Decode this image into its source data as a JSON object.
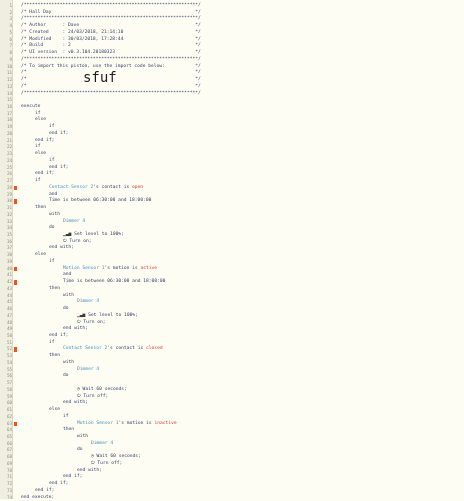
{
  "code_lines": [
    {
      "n": "1",
      "indent": 0,
      "tokens": [
        [
          "com",
          "/***************************************************************/"
        ]
      ]
    },
    {
      "n": "2",
      "indent": 0,
      "tokens": [
        [
          "com",
          "/* Hall Day                                                    */"
        ]
      ]
    },
    {
      "n": "3",
      "indent": 0,
      "tokens": [
        [
          "com",
          "/***************************************************************/"
        ]
      ]
    },
    {
      "n": "4",
      "indent": 0,
      "tokens": [
        [
          "com",
          "/* Author      : Dave                                          */"
        ]
      ]
    },
    {
      "n": "5",
      "indent": 0,
      "tokens": [
        [
          "com",
          "/* Created     : 24/03/2018, 21:14:10                          */"
        ]
      ]
    },
    {
      "n": "6",
      "indent": 0,
      "tokens": [
        [
          "com",
          "/* Modified    : 30/03/2018, 17:28:44                          */"
        ]
      ]
    },
    {
      "n": "7",
      "indent": 0,
      "tokens": [
        [
          "com",
          "/* Build       : 2                                             */"
        ]
      ]
    },
    {
      "n": "8",
      "indent": 0,
      "tokens": [
        [
          "com",
          "/* UI version  : v0.3.104.20180323                             */"
        ]
      ]
    },
    {
      "n": "9",
      "indent": 0,
      "tokens": [
        [
          "com",
          "/***************************************************************/"
        ]
      ]
    },
    {
      "n": "10",
      "indent": 0,
      "tokens": [
        [
          "com",
          "/* To import this piston, use the import code below:           */"
        ]
      ]
    },
    {
      "n": "11",
      "indent": 0,
      "tokens": [
        [
          "com",
          "/*                                                             */"
        ]
      ]
    },
    {
      "n": "12",
      "indent": 0,
      "tokens": [
        [
          "com",
          "/*                                                             */"
        ]
      ]
    },
    {
      "n": "13",
      "indent": 0,
      "tokens": [
        [
          "com",
          "/*                                                             */"
        ]
      ]
    },
    {
      "n": "14",
      "indent": 0,
      "tokens": [
        [
          "com",
          "/***************************************************************/"
        ]
      ]
    },
    {
      "n": "15",
      "indent": 0,
      "tokens": []
    },
    {
      "n": "16",
      "indent": 0,
      "tokens": [
        [
          "kw",
          "execute"
        ]
      ]
    },
    {
      "n": "17",
      "indent": 1,
      "tokens": [
        [
          "kw",
          "if"
        ]
      ]
    },
    {
      "n": "18",
      "indent": 1,
      "tokens": [
        [
          "kw",
          "else"
        ]
      ]
    },
    {
      "n": "19",
      "indent": 2,
      "tokens": [
        [
          "kw",
          "if"
        ]
      ]
    },
    {
      "n": "20",
      "indent": 2,
      "tokens": [
        [
          "kw",
          "end if;"
        ]
      ]
    },
    {
      "n": "21",
      "indent": 1,
      "tokens": [
        [
          "kw",
          "end if;"
        ]
      ]
    },
    {
      "n": "22",
      "indent": 1,
      "tokens": [
        [
          "kw",
          "if"
        ]
      ]
    },
    {
      "n": "23",
      "indent": 1,
      "tokens": [
        [
          "kw",
          "else"
        ]
      ]
    },
    {
      "n": "24",
      "indent": 2,
      "tokens": [
        [
          "kw",
          "if"
        ]
      ]
    },
    {
      "n": "25",
      "indent": 2,
      "tokens": [
        [
          "kw",
          "end if;"
        ]
      ]
    },
    {
      "n": "26",
      "indent": 1,
      "tokens": [
        [
          "kw",
          "end if;"
        ]
      ]
    },
    {
      "n": "27",
      "indent": 1,
      "tokens": [
        [
          "kw",
          "if"
        ]
      ]
    },
    {
      "n": "28",
      "indent": 2,
      "flag": true,
      "tokens": [
        [
          "dev",
          "Contact Sensor 2"
        ],
        [
          "txt",
          "'s contact is "
        ],
        [
          "val",
          "open"
        ]
      ]
    },
    {
      "n": "29",
      "indent": 2,
      "tokens": [
        [
          "kw",
          "and"
        ]
      ]
    },
    {
      "n": "30",
      "indent": 2,
      "flag": true,
      "tokens": [
        [
          "txt",
          "Time is between "
        ],
        [
          "num",
          "06:30:00"
        ],
        [
          "txt",
          " and "
        ],
        [
          "num",
          "18:00:00"
        ]
      ]
    },
    {
      "n": "31",
      "indent": 1,
      "tokens": [
        [
          "kw",
          "then"
        ]
      ]
    },
    {
      "n": "32",
      "indent": 2,
      "tokens": [
        [
          "kw",
          "with"
        ]
      ]
    },
    {
      "n": "33",
      "indent": 3,
      "tokens": [
        [
          "dev",
          "Dimmer 4"
        ]
      ]
    },
    {
      "n": "34",
      "indent": 2,
      "tokens": [
        [
          "kw",
          "do"
        ]
      ]
    },
    {
      "n": "35",
      "indent": 3,
      "tokens": [
        [
          "ico",
          "▁▃▅ "
        ],
        [
          "txt",
          "Set level to "
        ],
        [
          "num",
          "100%"
        ],
        [
          "txt",
          ";"
        ]
      ]
    },
    {
      "n": "36",
      "indent": 3,
      "tokens": [
        [
          "ico",
          "⏻ "
        ],
        [
          "txt",
          "Turn on;"
        ]
      ]
    },
    {
      "n": "37",
      "indent": 2,
      "tokens": [
        [
          "kw",
          "end with;"
        ]
      ]
    },
    {
      "n": "38",
      "indent": 1,
      "tokens": [
        [
          "kw",
          "else"
        ]
      ]
    },
    {
      "n": "39",
      "indent": 2,
      "tokens": [
        [
          "kw",
          "if"
        ]
      ]
    },
    {
      "n": "40",
      "indent": 3,
      "flag": true,
      "tokens": [
        [
          "dev",
          "Motion Sensor 1"
        ],
        [
          "txt",
          "'s motion is "
        ],
        [
          "val",
          "active"
        ]
      ]
    },
    {
      "n": "41",
      "indent": 3,
      "tokens": [
        [
          "kw",
          "and"
        ]
      ]
    },
    {
      "n": "42",
      "indent": 3,
      "flag": true,
      "tokens": [
        [
          "txt",
          "Time is between "
        ],
        [
          "num",
          "06:30:00"
        ],
        [
          "txt",
          " and "
        ],
        [
          "num",
          "18:00:00"
        ]
      ]
    },
    {
      "n": "43",
      "indent": 2,
      "tokens": [
        [
          "kw",
          "then"
        ]
      ]
    },
    {
      "n": "44",
      "indent": 3,
      "tokens": [
        [
          "kw",
          "with"
        ]
      ]
    },
    {
      "n": "45",
      "indent": 4,
      "tokens": [
        [
          "dev",
          "Dimmer 4"
        ]
      ]
    },
    {
      "n": "46",
      "indent": 3,
      "tokens": [
        [
          "kw",
          "do"
        ]
      ]
    },
    {
      "n": "47",
      "indent": 4,
      "tokens": [
        [
          "ico",
          "▁▃▅ "
        ],
        [
          "txt",
          "Set level to "
        ],
        [
          "num",
          "100%"
        ],
        [
          "txt",
          ";"
        ]
      ]
    },
    {
      "n": "48",
      "indent": 4,
      "tokens": [
        [
          "ico",
          "⏻ "
        ],
        [
          "txt",
          "Turn on;"
        ]
      ]
    },
    {
      "n": "49",
      "indent": 3,
      "tokens": [
        [
          "kw",
          "end with;"
        ]
      ]
    },
    {
      "n": "50",
      "indent": 2,
      "tokens": [
        [
          "kw",
          "end if;"
        ]
      ]
    },
    {
      "n": "51",
      "indent": 2,
      "tokens": [
        [
          "kw",
          "if"
        ]
      ]
    },
    {
      "n": "52",
      "indent": 3,
      "flag": true,
      "tokens": [
        [
          "dev",
          "Contact Sensor 2"
        ],
        [
          "txt",
          "'s contact is "
        ],
        [
          "val",
          "closed"
        ]
      ]
    },
    {
      "n": "53",
      "indent": 2,
      "tokens": [
        [
          "kw",
          "then"
        ]
      ]
    },
    {
      "n": "54",
      "indent": 3,
      "tokens": [
        [
          "kw",
          "with"
        ]
      ]
    },
    {
      "n": "55",
      "indent": 4,
      "tokens": [
        [
          "dev",
          "Dimmer 4"
        ]
      ]
    },
    {
      "n": "56",
      "indent": 3,
      "tokens": [
        [
          "kw",
          "do"
        ]
      ]
    },
    {
      "n": "57",
      "indent": 4,
      "tokens": []
    },
    {
      "n": "58",
      "indent": 4,
      "tokens": [
        [
          "ico",
          "◷ "
        ],
        [
          "txt",
          "Wait "
        ],
        [
          "num",
          "60"
        ],
        [
          "txt",
          " seconds;"
        ]
      ]
    },
    {
      "n": "59",
      "indent": 4,
      "tokens": [
        [
          "ico",
          "⏻ "
        ],
        [
          "txt",
          "Turn off;"
        ]
      ]
    },
    {
      "n": "60",
      "indent": 3,
      "tokens": [
        [
          "kw",
          "end with;"
        ]
      ]
    },
    {
      "n": "61",
      "indent": 2,
      "tokens": [
        [
          "kw",
          "else"
        ]
      ]
    },
    {
      "n": "62",
      "indent": 3,
      "tokens": [
        [
          "kw",
          "if"
        ]
      ]
    },
    {
      "n": "63",
      "indent": 4,
      "flag": true,
      "tokens": [
        [
          "dev",
          "Motion Sensor 1"
        ],
        [
          "txt",
          "'s motion is "
        ],
        [
          "val",
          "inactive"
        ]
      ]
    },
    {
      "n": "64",
      "indent": 3,
      "tokens": [
        [
          "kw",
          "then"
        ]
      ]
    },
    {
      "n": "65",
      "indent": 4,
      "tokens": [
        [
          "kw",
          "with"
        ]
      ]
    },
    {
      "n": "66",
      "indent": 5,
      "tokens": [
        [
          "dev",
          "Dimmer 4"
        ]
      ]
    },
    {
      "n": "67",
      "indent": 4,
      "tokens": [
        [
          "kw",
          "do"
        ]
      ]
    },
    {
      "n": "68",
      "indent": 5,
      "tokens": [
        [
          "ico",
          "◷ "
        ],
        [
          "txt",
          "Wait "
        ],
        [
          "num",
          "60"
        ],
        [
          "txt",
          " seconds;"
        ]
      ]
    },
    {
      "n": "69",
      "indent": 5,
      "tokens": [
        [
          "ico",
          "⏻ "
        ],
        [
          "txt",
          "Turn off;"
        ]
      ]
    },
    {
      "n": "70",
      "indent": 4,
      "tokens": [
        [
          "kw",
          "end with;"
        ]
      ]
    },
    {
      "n": "71",
      "indent": 3,
      "tokens": [
        [
          "kw",
          "end if;"
        ]
      ]
    },
    {
      "n": "72",
      "indent": 2,
      "tokens": [
        [
          "kw",
          "end if;"
        ]
      ]
    },
    {
      "n": "73",
      "indent": 1,
      "tokens": [
        [
          "kw",
          "end if;"
        ]
      ]
    },
    {
      "n": "74",
      "indent": 0,
      "tokens": [
        [
          "kw",
          "end execute;"
        ]
      ]
    }
  ],
  "import_code": "sfuf",
  "colors": {
    "background": "#fdfdf3",
    "gutter": "#efefdf",
    "keyword": "#2f3b63",
    "device": "#3f8ebd",
    "value": "#d23b2f",
    "flag": "#e4572e"
  }
}
